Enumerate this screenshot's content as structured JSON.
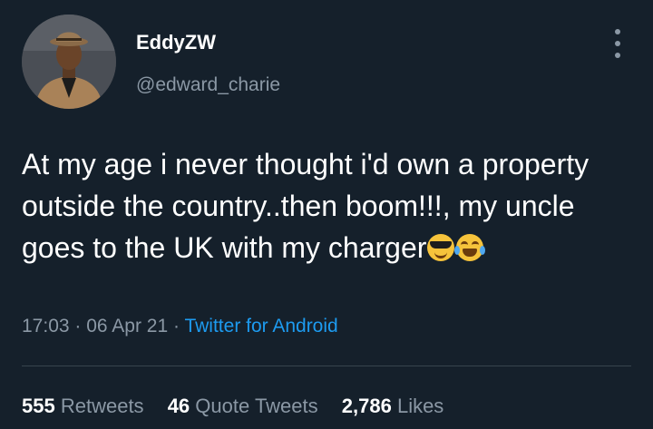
{
  "user": {
    "display_name": "EddyZW",
    "handle": "@edward_charie",
    "avatar_icon": "profile-photo"
  },
  "tweet": {
    "text": "At my age i never thought i'd own a property outside the country..then boom!!!, my uncle goes to the UK with my charger",
    "emojis": [
      "smiling-face-with-sunglasses",
      "face-with-tears-of-joy"
    ],
    "time": "17:03",
    "separator": "·",
    "date": "06 Apr 21",
    "source": "Twitter for Android"
  },
  "stats": {
    "retweets": {
      "count": "555",
      "label": "Retweets"
    },
    "quote_tweets": {
      "count": "46",
      "label": "Quote Tweets"
    },
    "likes": {
      "count": "2,786",
      "label": "Likes"
    }
  },
  "colors": {
    "background": "#15202b",
    "text": "#ffffff",
    "secondary": "#8b98a5",
    "link": "#1d9bf0",
    "divider": "#38444d"
  }
}
